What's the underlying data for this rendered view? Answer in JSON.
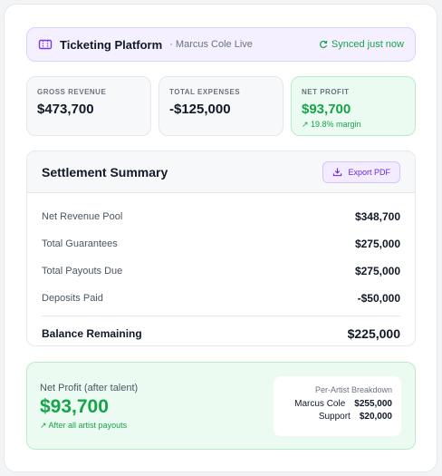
{
  "header": {
    "title": "Ticketing Platform",
    "subtitle": "· Marcus Cole Live",
    "sync_status": "Synced just now",
    "accent_color": "#7c3aed",
    "sync_color": "#16a34a"
  },
  "stats": [
    {
      "label": "GROSS REVENUE",
      "value": "$473,700"
    },
    {
      "label": "TOTAL EXPENSES",
      "value": "-$125,000"
    },
    {
      "label": "NET PROFIT",
      "value": "$93,700",
      "note": "↗ 19.8% margin"
    }
  ],
  "summary": {
    "title": "Settlement Summary",
    "export_label": "Export PDF",
    "rows": [
      {
        "label": "Net Revenue Pool",
        "value": "$348,700"
      },
      {
        "label": "Total Guarantees",
        "value": "$275,000"
      },
      {
        "label": "Total Payouts Due",
        "value": "$275,000"
      },
      {
        "label": "Deposits Paid",
        "value": "-$50,000"
      }
    ],
    "balance_label": "Balance Remaining",
    "balance_value": "$225,000"
  },
  "net_profit": {
    "label": "Net Profit (after talent)",
    "value": "$93,700",
    "note": "↗ After all artist payouts",
    "breakdown_title": "Per-Artist Breakdown",
    "breakdown": [
      {
        "name": "Marcus Cole",
        "amount": "$255,000"
      },
      {
        "name": "Support",
        "amount": "$20,000"
      }
    ]
  }
}
